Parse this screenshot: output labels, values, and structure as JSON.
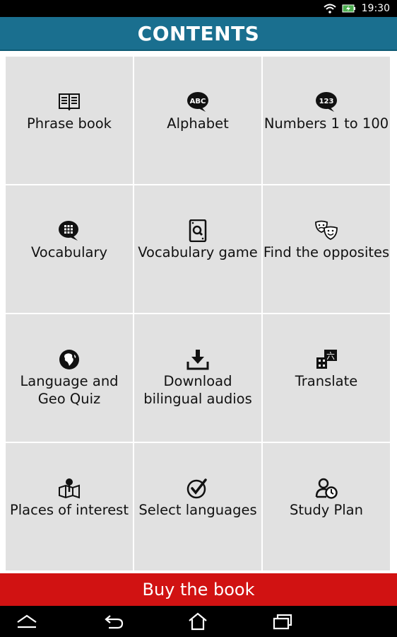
{
  "status_bar": {
    "time": "19:30",
    "icons": [
      "wifi-icon",
      "battery-charging-icon"
    ]
  },
  "header": {
    "title": "CONTENTS"
  },
  "tiles": [
    {
      "label": "Phrase book",
      "icon": "book-icon"
    },
    {
      "label": "Alphabet",
      "icon": "abc-bubble-icon",
      "icon_text": "ABC"
    },
    {
      "label": "Numbers 1 to 100",
      "icon": "numbers-bubble-icon",
      "icon_text": "123"
    },
    {
      "label": "Vocabulary",
      "icon": "grid-bubble-icon"
    },
    {
      "label": "Vocabulary game",
      "icon": "card-search-icon"
    },
    {
      "label": "Find the opposites",
      "icon": "theater-masks-icon"
    },
    {
      "label": "Language and Geo Quiz",
      "icon": "globe-icon"
    },
    {
      "label": "Download bilingual audios",
      "icon": "download-icon"
    },
    {
      "label": "Translate",
      "icon": "translate-icon",
      "icon_text": "六"
    },
    {
      "label": "Places of interest",
      "icon": "map-pin-icon"
    },
    {
      "label": "Select languages",
      "icon": "checkmark-circle-icon"
    },
    {
      "label": "Study Plan",
      "icon": "user-clock-icon"
    }
  ],
  "buy_bar": {
    "label": "Buy the book"
  },
  "nav_bar": {
    "buttons": [
      "home-up-icon",
      "back-icon",
      "home-icon",
      "recent-apps-icon"
    ]
  },
  "colors": {
    "header": "#1a6f8f",
    "tile": "#e1e1e1",
    "buy_bar": "#d11212",
    "status_bar": "#000000"
  }
}
